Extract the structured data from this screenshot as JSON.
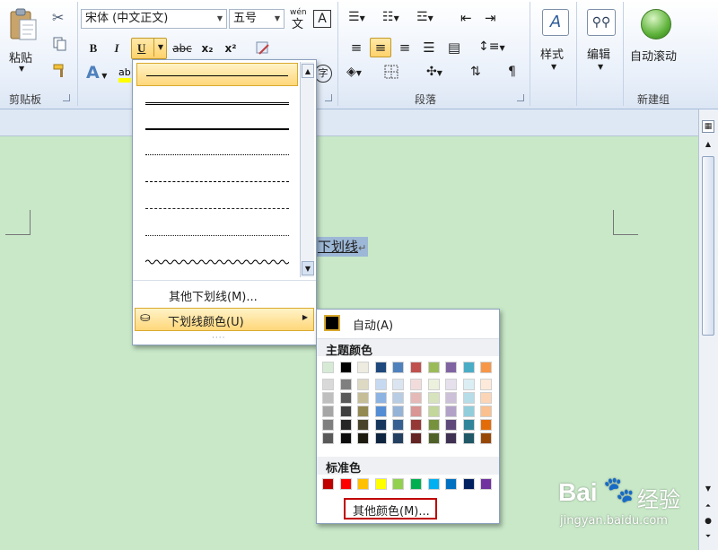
{
  "ribbon": {
    "clipboard": {
      "paste_label": "粘贴",
      "group_label": "剪贴板"
    },
    "font": {
      "font_name": "宋体 (中文正文)",
      "font_size": "五号",
      "phonetic_glyph": "wén",
      "bold": "B",
      "italic": "I",
      "underline": "U",
      "strike": "abc",
      "subscript": "x₂",
      "superscript": "x²",
      "text_effect": "A",
      "circle_glyph": "字"
    },
    "paragraph": {
      "group_label": "段落"
    },
    "styles": {
      "label": "样式"
    },
    "editing": {
      "label": "编辑"
    },
    "new_group": {
      "button_label": "自动滚动",
      "group_label": "新建组"
    }
  },
  "document": {
    "selected_text": "下划线",
    "para_mark": "↵"
  },
  "underline_menu": {
    "more_underlines": "其他下划线(M)...",
    "underline_color": "下划线颜色(U)",
    "grip": "····"
  },
  "color_menu": {
    "auto_label": "自动(A)",
    "theme_title": "主题颜色",
    "standard_title": "标准色",
    "more_colors": "其他颜色(M)...",
    "theme_colors": [
      [
        "#d6ead6",
        "#d9d9d9",
        "#bfbfbf",
        "#a6a6a6",
        "#7f7f7f",
        "#595959"
      ],
      [
        "#000000",
        "#7f7f7f",
        "#595959",
        "#3f3f3f",
        "#262626",
        "#0d0d0d"
      ],
      [
        "#eeece1",
        "#ddd9c3",
        "#c4bd97",
        "#938953",
        "#494429",
        "#1d1b10"
      ],
      [
        "#1f497d",
        "#c6d9f0",
        "#8db3e2",
        "#548dd4",
        "#17365d",
        "#0f243e"
      ],
      [
        "#4f81bd",
        "#dbe5f1",
        "#b8cce4",
        "#95b3d7",
        "#366092",
        "#244061"
      ],
      [
        "#c0504d",
        "#f2dcdb",
        "#e5b9b7",
        "#d99694",
        "#953734",
        "#632423"
      ],
      [
        "#9bbb59",
        "#ebf1dd",
        "#d7e3bc",
        "#c3d69b",
        "#76923c",
        "#4f6128"
      ],
      [
        "#8064a2",
        "#e5e0ec",
        "#ccc1d9",
        "#b2a2c7",
        "#5f497a",
        "#3f3151"
      ],
      [
        "#4bacc6",
        "#dbeef3",
        "#b7dde8",
        "#92cddc",
        "#31859b",
        "#205867"
      ],
      [
        "#f79646",
        "#fdeada",
        "#fbd5b5",
        "#fac08f",
        "#e36c09",
        "#974806"
      ]
    ],
    "standard_colors": [
      "#c00000",
      "#ff0000",
      "#ffc000",
      "#ffff00",
      "#92d050",
      "#00b050",
      "#00b0f0",
      "#0070c0",
      "#002060",
      "#7030a0"
    ]
  },
  "watermark": {
    "brand": "Bai",
    "brand2": "经验",
    "url": "jingyan.baidu.com"
  }
}
